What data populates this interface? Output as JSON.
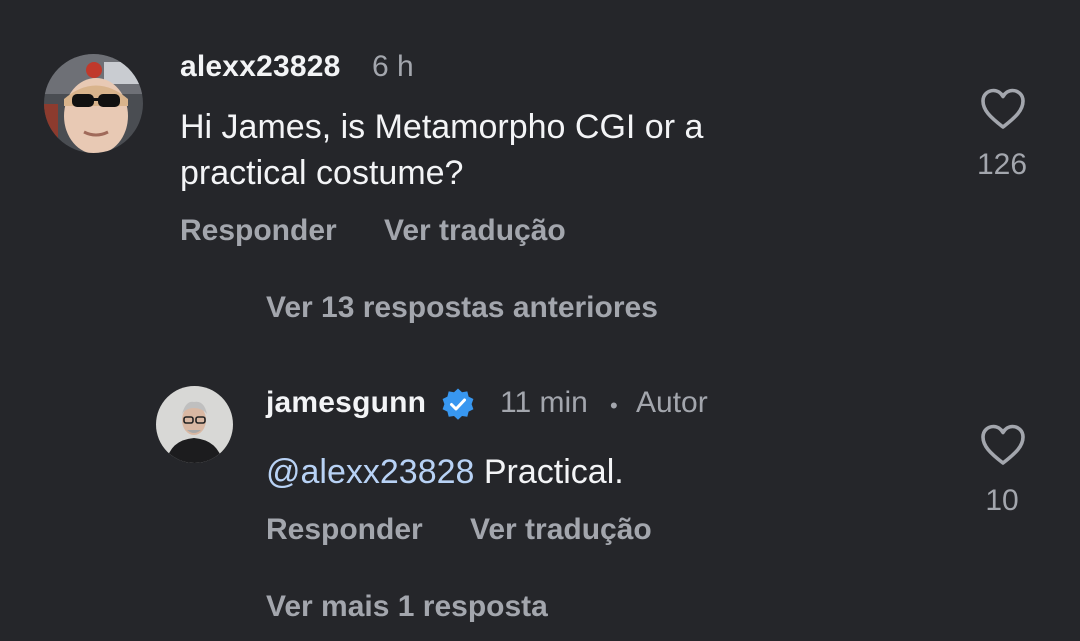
{
  "colors": {
    "background": "#25262a",
    "primary_text": "#f3f4f6",
    "secondary_text": "#a3a6ad",
    "mention": "#b8d2f5",
    "verified_badge": "#3897f0"
  },
  "comment": {
    "username": "alexx23828",
    "time": "6 h",
    "text_line1": "Hi James, is Metamorpho CGI or a",
    "text_line2": "practical costume?",
    "reply_label": "Responder",
    "translate_label": "Ver tradução",
    "like_icon": "heart-outline-icon",
    "like_count": "126"
  },
  "view_previous_replies": "Ver 13 respostas anteriores",
  "reply": {
    "username": "jamesgunn",
    "verified_icon": "verified-badge-icon",
    "time": "11 min",
    "separator": "•",
    "author_label": "Autor",
    "mention": "@alexx23828",
    "text": " Practical.",
    "reply_label": "Responder",
    "translate_label": "Ver tradução",
    "like_icon": "heart-outline-icon",
    "like_count": "10"
  },
  "view_more_replies": "Ver mais 1 resposta"
}
